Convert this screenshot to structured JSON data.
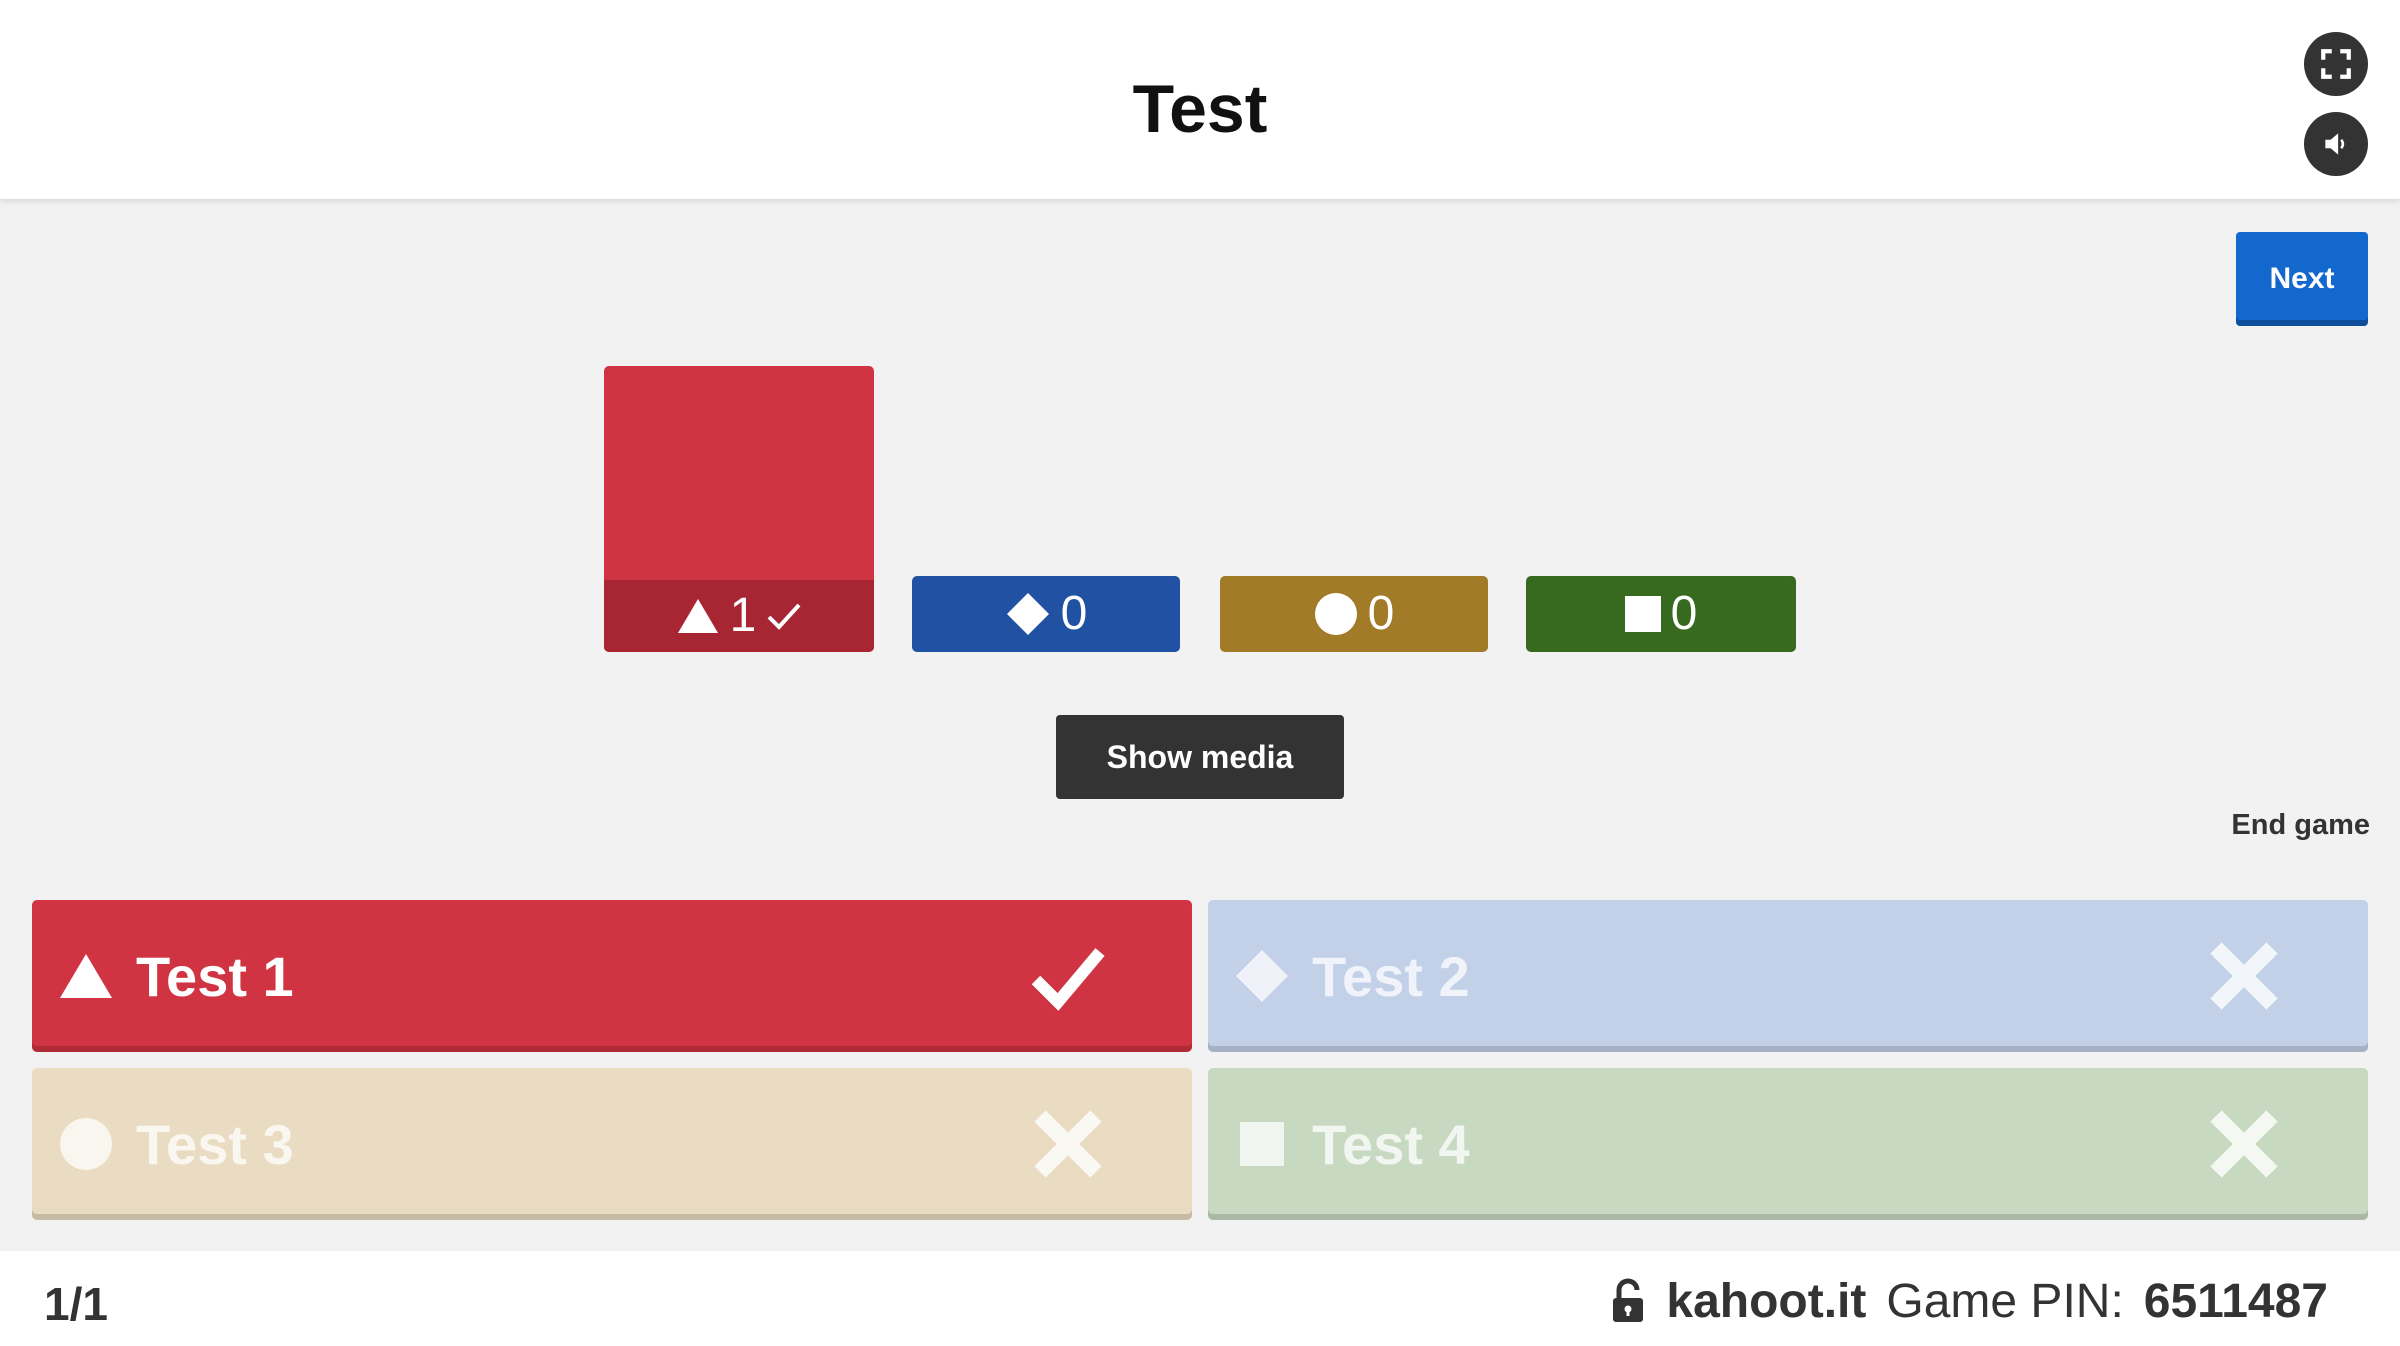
{
  "header": {
    "title": "Test",
    "fullscreen_icon": "expand-icon",
    "sound_icon": "speaker-icon"
  },
  "controls": {
    "next_label": "Next",
    "show_media_label": "Show media",
    "end_game_label": "End game"
  },
  "results": [
    {
      "shape": "triangle",
      "count": "1",
      "correct": true,
      "color": "#d03341",
      "label_color": "#a82633",
      "value": 1
    },
    {
      "shape": "diamond",
      "count": "0",
      "correct": false,
      "color": "#2151a2",
      "value": 0
    },
    {
      "shape": "circle",
      "count": "0",
      "correct": false,
      "color": "#a27b28",
      "value": 0
    },
    {
      "shape": "square",
      "count": "0",
      "correct": false,
      "color": "#376a1f",
      "value": 0
    }
  ],
  "answers": [
    {
      "shape": "triangle",
      "text": "Test 1",
      "correct": true,
      "color": "#d03341"
    },
    {
      "shape": "diamond",
      "text": "Test 2",
      "correct": false,
      "color": "#c2d0e8"
    },
    {
      "shape": "circle",
      "text": "Test 3",
      "correct": false,
      "color": "#e9dcc2"
    },
    {
      "shape": "square",
      "text": "Test 4",
      "correct": false,
      "color": "#c8d9c1"
    }
  ],
  "footer": {
    "question_count": "1/1",
    "site": "kahoot.it",
    "pin_label": "Game PIN:",
    "pin_value": "6511487"
  }
}
